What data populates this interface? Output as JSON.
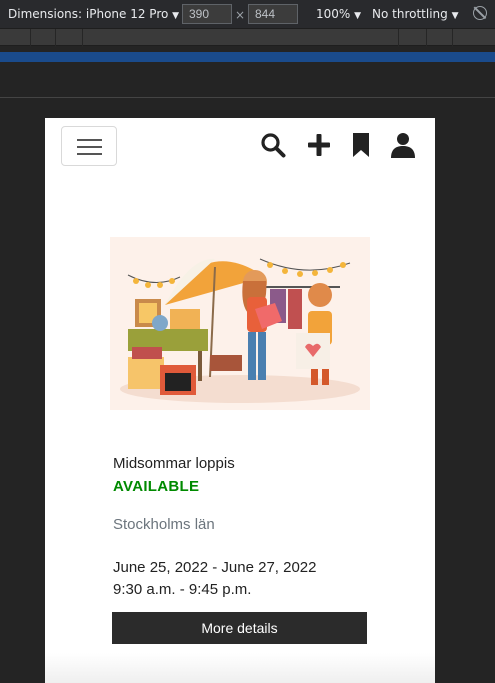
{
  "devtools": {
    "device": "Dimensions: iPhone 12 Pro",
    "width": "390",
    "height": "844",
    "times_sign": "×",
    "zoom": "100%",
    "throttling": "No throttling",
    "dropdown_icon": "caret-down-icon",
    "rotate_icon": "rotate-icon",
    "media_query_color": "#1a4b8c"
  },
  "nav": {
    "menu_icon": "hamburger-menu-icon",
    "icons": [
      "search-icon",
      "plus-icon",
      "bookmark-icon",
      "user-icon"
    ]
  },
  "event": {
    "image": "flea-market-illustration",
    "title": "Midsommar loppis",
    "status": "AVAILABLE",
    "status_color": "#008a00",
    "region": "Stockholms län",
    "dates": "June 25, 2022 - June 27, 2022",
    "times": "9:30 a.m. - 9:45 p.m.",
    "button_label": "More details"
  }
}
